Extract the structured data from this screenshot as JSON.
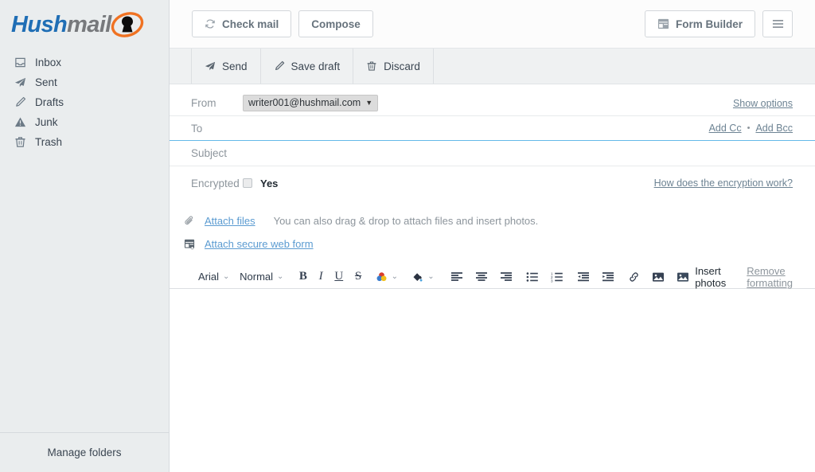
{
  "brand": {
    "name_part1": "Hush",
    "name_part2": "mail",
    "logo_icon": "keyhole-lock-icon",
    "color_blue": "#1f6eb5",
    "color_gray": "#77797c",
    "color_orange": "#f07222"
  },
  "sidebar": {
    "items": [
      {
        "label": "Inbox",
        "icon": "inbox-tray-icon"
      },
      {
        "label": "Sent",
        "icon": "paper-plane-icon"
      },
      {
        "label": "Drafts",
        "icon": "pencil-icon"
      },
      {
        "label": "Junk",
        "icon": "warning-triangle-icon"
      },
      {
        "label": "Trash",
        "icon": "trash-can-icon"
      }
    ],
    "manage_folders": "Manage folders"
  },
  "topbar": {
    "check_mail": "Check mail",
    "check_mail_icon": "refresh-icon",
    "compose": "Compose",
    "form_builder": "Form Builder",
    "form_builder_icon": "form-window-icon",
    "menu_icon": "hamburger-menu-icon"
  },
  "actionbar": {
    "send": "Send",
    "send_icon": "paper-plane-icon",
    "save_draft": "Save draft",
    "save_draft_icon": "pencil-icon",
    "discard": "Discard",
    "discard_icon": "trash-can-icon"
  },
  "compose": {
    "from_label": "From",
    "from_value": "writer001@hushmail.com",
    "show_options": "Show options",
    "to_label": "To",
    "to_value": "",
    "add_cc": "Add Cc",
    "separator": "•",
    "add_bcc": "Add Bcc",
    "subject_label": "Subject",
    "subject_value": "",
    "encrypted_label": "Encrypted",
    "encrypted_yes": "Yes",
    "encrypted_checked": false,
    "encryption_help": "How does the encryption work?",
    "attach_files": "Attach files",
    "attach_files_icon": "paperclip-icon",
    "attach_hint": "You can also drag & drop to attach files and insert photos.",
    "attach_web_form": "Attach secure web form",
    "attach_web_form_icon": "form-add-icon",
    "body_value": ""
  },
  "format_toolbar": {
    "font_family": "Arial",
    "font_size": "Normal",
    "bold": "B",
    "italic": "I",
    "underline": "U",
    "strikethrough": "S",
    "text_color_icon": "text-color-icon",
    "fill_color_icon": "fill-color-icon",
    "align_left_icon": "align-left-icon",
    "align_center_icon": "align-center-icon",
    "align_right_icon": "align-right-icon",
    "bullet_list_icon": "bullet-list-icon",
    "numbered_list_icon": "numbered-list-icon",
    "outdent_icon": "outdent-icon",
    "indent_icon": "indent-icon",
    "link_icon": "link-icon",
    "image_icon": "image-icon",
    "insert_photos": "Insert photos",
    "insert_photos_icon": "photo-icon",
    "remove_formatting": "Remove formatting"
  }
}
